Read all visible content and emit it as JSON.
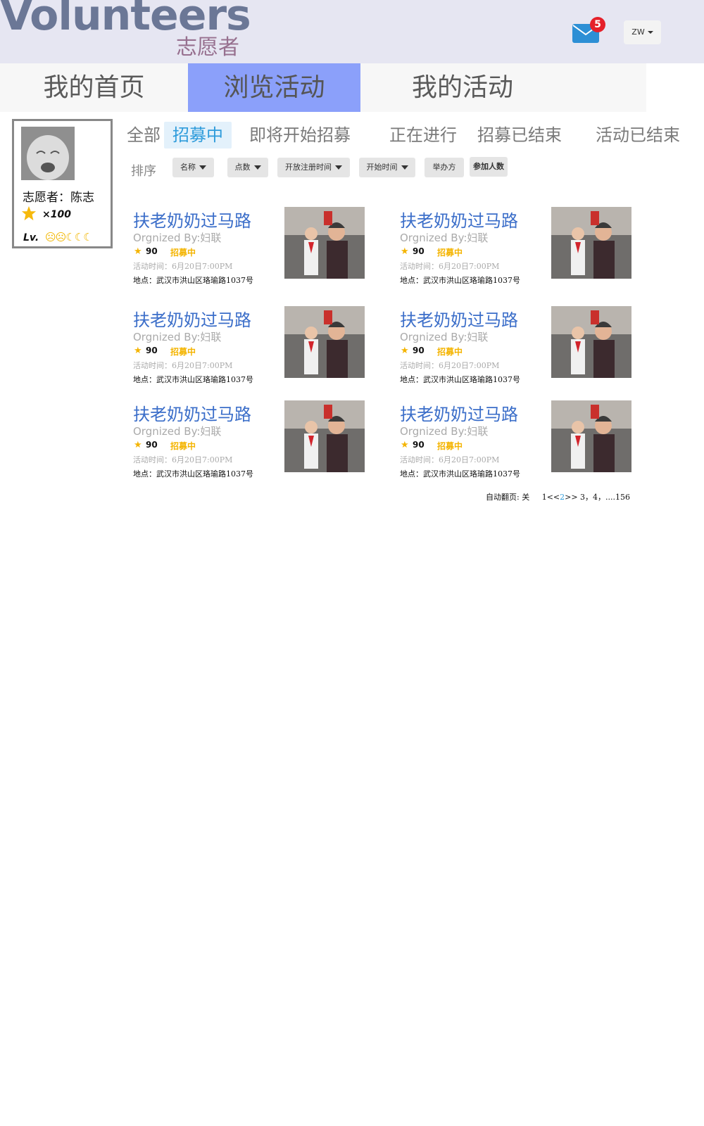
{
  "header": {
    "logo_main": "Volunteers",
    "logo_sub": "志愿者",
    "mail_count": "5",
    "lang": "ZW"
  },
  "main_nav": {
    "tabs": [
      {
        "label": "我的首页",
        "active": false
      },
      {
        "label": "浏览活动",
        "active": true
      },
      {
        "label": "我的活动",
        "active": false
      }
    ]
  },
  "profile": {
    "name": "志愿者：陈志",
    "points": "×100",
    "level_label": "Lv."
  },
  "filters": [
    "全部",
    "招募中",
    "即将开始招募",
    "正在进行",
    "招募已结束",
    "活动已结束"
  ],
  "filter_active": "招募中",
  "sort": {
    "label": "排序",
    "options": [
      "名称",
      "点数",
      "开放注册时间",
      "开始时间",
      "举办方",
      "参加人数"
    ]
  },
  "activities": [
    {
      "title": "扶老奶奶过马路",
      "org": "Orgnized By:妇联",
      "points": "90",
      "status": "招募中",
      "time": "活动时间：6月20日7:00PM",
      "place": "地点：武汉市洪山区珞瑜路1037号"
    },
    {
      "title": "扶老奶奶过马路",
      "org": "Orgnized By:妇联",
      "points": "90",
      "status": "招募中",
      "time": "活动时间：6月20日7:00PM",
      "place": "地点：武汉市洪山区珞瑜路1037号"
    },
    {
      "title": "扶老奶奶过马路",
      "org": "Orgnized By:妇联",
      "points": "90",
      "status": "招募中",
      "time": "活动时间：6月20日7:00PM",
      "place": "地点：武汉市洪山区珞瑜路1037号"
    },
    {
      "title": "扶老奶奶过马路",
      "org": "Orgnized By:妇联",
      "points": "90",
      "status": "招募中",
      "time": "活动时间：6月20日7:00PM",
      "place": "地点：武汉市洪山区珞瑜路1037号"
    },
    {
      "title": "扶老奶奶过马路",
      "org": "Orgnized By:妇联",
      "points": "90",
      "status": "招募中",
      "time": "活动时间：6月20日7:00PM",
      "place": "地点：武汉市洪山区珞瑜路1037号"
    },
    {
      "title": "扶老奶奶过马路",
      "org": "Orgnized By:妇联",
      "points": "90",
      "status": "招募中",
      "time": "活动时间：6月20日7:00PM",
      "place": "地点：武汉市洪山区珞瑜路1037号"
    }
  ],
  "pager": {
    "auto_label": "自动翻页: 关",
    "first": "1",
    "prev": "<<",
    "current": "2",
    "next": ">>",
    "rest": " 3，4，....156"
  },
  "colors": {
    "header_bg": "#e6e6f2",
    "nav_active": "#8ba0fa",
    "title_blue": "#3b6ec9",
    "status_yellow": "#f4b400",
    "badge_red": "#e5202a"
  }
}
